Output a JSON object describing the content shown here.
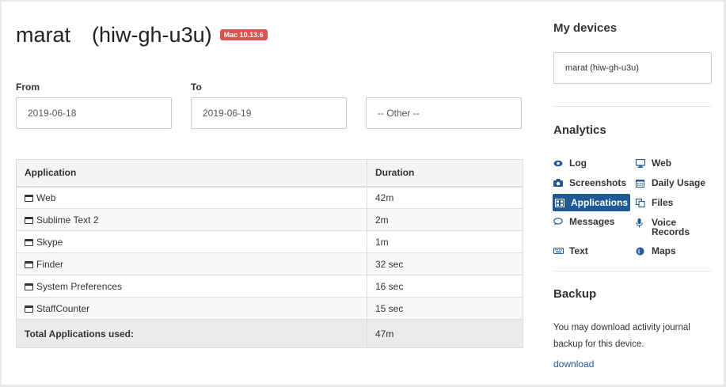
{
  "header": {
    "user": "marat",
    "host": "(hiw-gh-u3u)",
    "os_badge": "Mac 10.13.6"
  },
  "filters": {
    "from_label": "From",
    "from_value": "2019-06-18",
    "to_label": "To",
    "to_value": "2019-06-19",
    "other_value": "-- Other --"
  },
  "table": {
    "columns": [
      "Application",
      "Duration"
    ],
    "rows": [
      {
        "app": "Web",
        "duration": "42m"
      },
      {
        "app": "Sublime Text 2",
        "duration": "2m"
      },
      {
        "app": "Skype",
        "duration": "1m"
      },
      {
        "app": "Finder",
        "duration": "32 sec"
      },
      {
        "app": "System Preferences",
        "duration": "16 sec"
      },
      {
        "app": "StaffCounter",
        "duration": "15 sec"
      }
    ],
    "total_label": "Total Applications used:",
    "total_value": "47m"
  },
  "sidebar": {
    "devices_title": "My devices",
    "device": "marat (hiw-gh-u3u)",
    "analytics_title": "Analytics",
    "nav": [
      {
        "label": "Log",
        "icon": "eye-icon"
      },
      {
        "label": "Web",
        "icon": "monitor-icon"
      },
      {
        "label": "Screenshots",
        "icon": "camera-icon"
      },
      {
        "label": "Daily Usage",
        "icon": "calendar-icon"
      },
      {
        "label": "Applications",
        "icon": "applications-icon",
        "active": true
      },
      {
        "label": "Files",
        "icon": "files-icon"
      },
      {
        "label": "Messages",
        "icon": "speech-bubble-icon"
      },
      {
        "label": "Voice Records",
        "icon": "microphone-icon"
      },
      {
        "label": "Text",
        "icon": "keyboard-icon"
      },
      {
        "label": "Maps",
        "icon": "globe-icon"
      }
    ],
    "backup_title": "Backup",
    "backup_text": "You may download activity journal backup for this device.",
    "download_link": "download"
  },
  "colors": {
    "accent": "#1f5a94",
    "badge": "#d9534f"
  }
}
